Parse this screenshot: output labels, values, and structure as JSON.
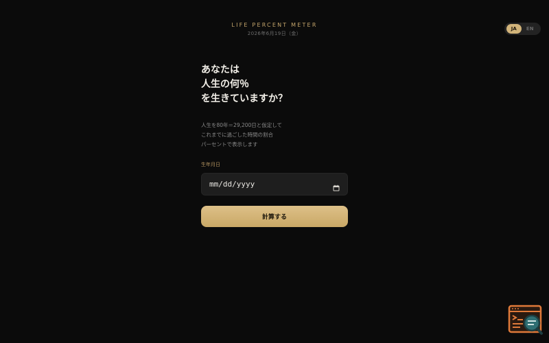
{
  "header": {
    "title": "LIFE PERCENT METER",
    "date": "2026年6月19日（金）"
  },
  "lang_toggle": {
    "options": [
      "JA",
      "EN"
    ],
    "active": "JA"
  },
  "hero": {
    "lines": [
      "あなたは",
      "人生の何％",
      "を生きていますか？"
    ]
  },
  "description": {
    "lines": [
      "人生を80年＝29,200日と仮定して",
      "これまでに過ごした時間の割合",
      "パーセントで表示します"
    ]
  },
  "form": {
    "birthdate_label": "生年月日",
    "birthdate_placeholder": "mm/dd/yyyy",
    "submit_label": "計算する"
  },
  "icons": {
    "date_picker": "calendar-icon",
    "floating_widget": "browser-search-icon"
  },
  "colors": {
    "background": "#0b0b0b",
    "accent": "#c9a96b",
    "heading_text": "#f2efe8",
    "input_background": "#1e1e1e"
  }
}
